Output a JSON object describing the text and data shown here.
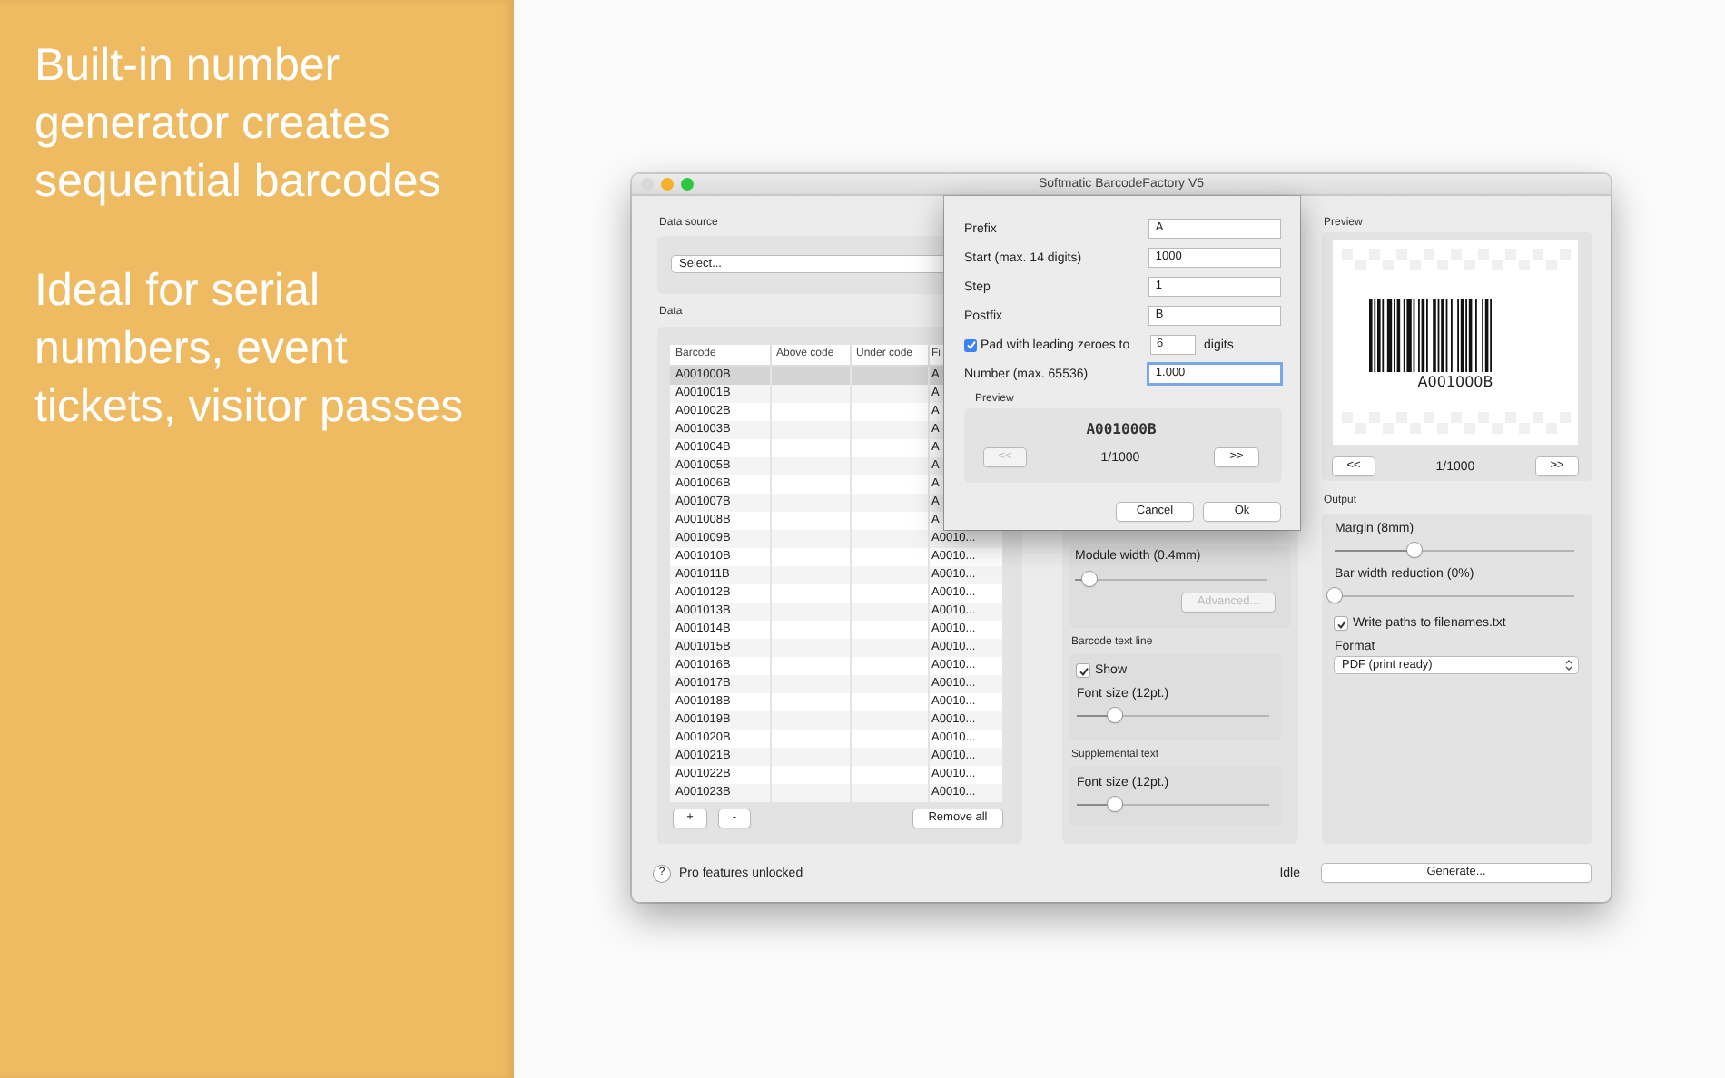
{
  "promo": {
    "headline": "Built-in number generator creates sequential barcodes",
    "subhead": "Ideal for serial numbers, event tickets, visitor passes"
  },
  "window": {
    "title": "Softmatic BarcodeFactory V5"
  },
  "data_source": {
    "label": "Data source",
    "select": "Select..."
  },
  "data": {
    "label": "Data",
    "columns": [
      "Barcode",
      "Above code",
      "Under code",
      "Fi"
    ],
    "rows": [
      {
        "cells": [
          "A001000B",
          "",
          "",
          "A"
        ],
        "selected": true
      },
      {
        "cells": [
          "A001001B",
          "",
          "",
          "A"
        ],
        "selected": false
      },
      {
        "cells": [
          "A001002B",
          "",
          "",
          "A"
        ],
        "selected": false
      },
      {
        "cells": [
          "A001003B",
          "",
          "",
          "A"
        ],
        "selected": false
      },
      {
        "cells": [
          "A001004B",
          "",
          "",
          "A"
        ],
        "selected": false
      },
      {
        "cells": [
          "A001005B",
          "",
          "",
          "A"
        ],
        "selected": false
      },
      {
        "cells": [
          "A001006B",
          "",
          "",
          "A"
        ],
        "selected": false
      },
      {
        "cells": [
          "A001007B",
          "",
          "",
          "A"
        ],
        "selected": false
      },
      {
        "cells": [
          "A001008B",
          "",
          "",
          "A"
        ],
        "selected": false
      },
      {
        "cells": [
          "A001009B",
          "",
          "",
          "A0010..."
        ],
        "selected": false
      },
      {
        "cells": [
          "A001010B",
          "",
          "",
          "A0010..."
        ],
        "selected": false
      },
      {
        "cells": [
          "A001011B",
          "",
          "",
          "A0010..."
        ],
        "selected": false
      },
      {
        "cells": [
          "A001012B",
          "",
          "",
          "A0010..."
        ],
        "selected": false
      },
      {
        "cells": [
          "A001013B",
          "",
          "",
          "A0010..."
        ],
        "selected": false
      },
      {
        "cells": [
          "A001014B",
          "",
          "",
          "A0010..."
        ],
        "selected": false
      },
      {
        "cells": [
          "A001015B",
          "",
          "",
          "A0010..."
        ],
        "selected": false
      },
      {
        "cells": [
          "A001016B",
          "",
          "",
          "A0010..."
        ],
        "selected": false
      },
      {
        "cells": [
          "A001017B",
          "",
          "",
          "A0010..."
        ],
        "selected": false
      },
      {
        "cells": [
          "A001018B",
          "",
          "",
          "A0010..."
        ],
        "selected": false
      },
      {
        "cells": [
          "A001019B",
          "",
          "",
          "A0010..."
        ],
        "selected": false
      },
      {
        "cells": [
          "A001020B",
          "",
          "",
          "A0010..."
        ],
        "selected": false
      },
      {
        "cells": [
          "A001021B",
          "",
          "",
          "A0010..."
        ],
        "selected": false
      },
      {
        "cells": [
          "A001022B",
          "",
          "",
          "A0010..."
        ],
        "selected": false
      },
      {
        "cells": [
          "A001023B",
          "",
          "",
          "A0010..."
        ],
        "selected": false
      }
    ],
    "buttons": [
      "+",
      "-",
      "Remove all"
    ]
  },
  "barcode_panel": {
    "module_width": {
      "label": "Module width (0.4mm)",
      "level": 0.08
    },
    "advanced_button": {
      "label": "Advanced...",
      "disabled": true
    },
    "text_line": {
      "title": "Barcode text line",
      "show": {
        "label": "Show",
        "checked": true
      },
      "font_size": {
        "label": "Font size (12pt.)",
        "level": 0.2
      }
    },
    "supplemental": {
      "title": "Supplemental text",
      "font_size": {
        "label": "Font size (12pt.)",
        "level": 0.2
      }
    }
  },
  "preview": {
    "label": "Preview",
    "barcode_text": "A001000B",
    "prev": "<<",
    "counter": "1/1000",
    "next": ">>"
  },
  "output": {
    "label": "Output",
    "margin": {
      "label": "Margin (8mm)",
      "level": 0.33
    },
    "bar_width_reduction": {
      "label": "Bar width reduction (0%)",
      "level": 0.0
    },
    "write_paths": {
      "label": "Write paths to filenames.txt",
      "checked": true
    },
    "format": {
      "label": "Format",
      "value": "PDF (print ready)"
    }
  },
  "status": {
    "help": "?",
    "pro": "Pro features unlocked",
    "state": "Idle",
    "generate": "Generate..."
  },
  "dialog": {
    "fields": [
      {
        "label": "Prefix",
        "value": "A"
      },
      {
        "label": "Start (max. 14 digits)",
        "value": "1000"
      },
      {
        "label": "Step",
        "value": "1"
      },
      {
        "label": "Postfix",
        "value": "B"
      }
    ],
    "pad": {
      "label": "Pad with leading zeroes to",
      "checked": true,
      "value": "6",
      "unit": "digits"
    },
    "number": {
      "label": "Number (max. 65536)",
      "value": "1.000",
      "focused": true
    },
    "preview": {
      "label": "Preview",
      "text": "A001000B",
      "prev": {
        "label": "<<",
        "disabled": true
      },
      "counter": "1/1000",
      "next": {
        "label": ">>",
        "disabled": false
      }
    },
    "buttons": [
      "Cancel",
      "Ok"
    ]
  }
}
